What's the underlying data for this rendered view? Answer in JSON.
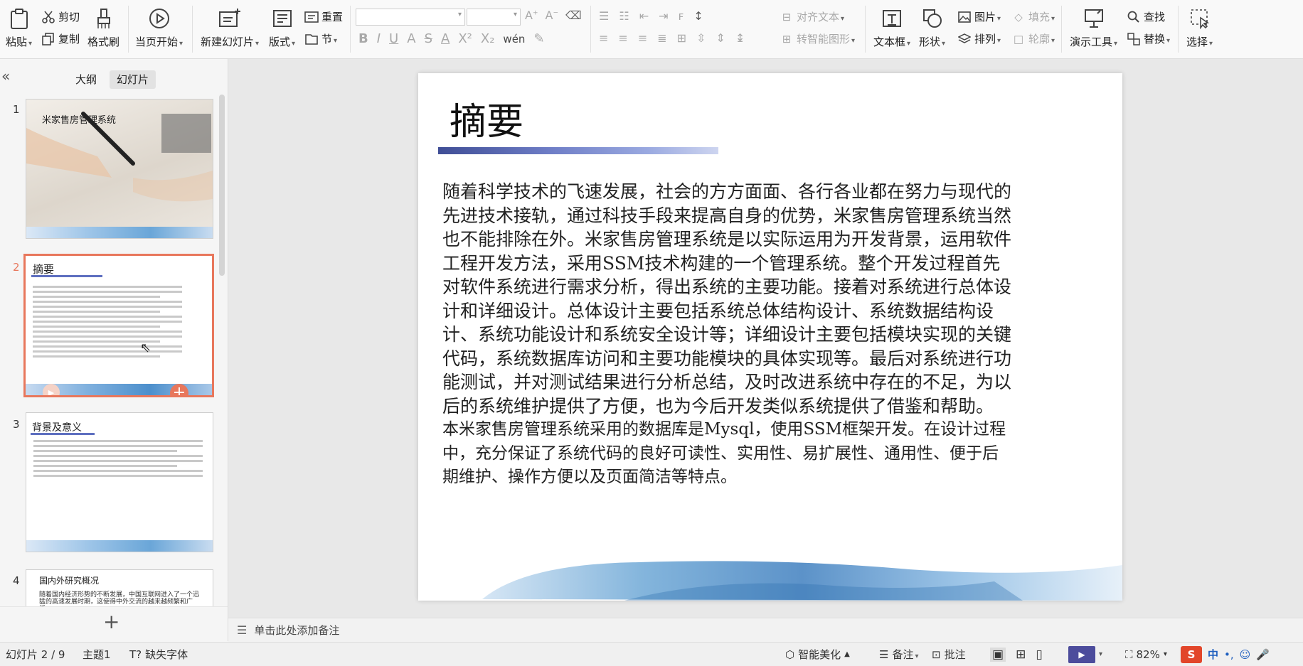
{
  "ribbon": {
    "paste": "粘贴",
    "cut": "剪切",
    "copy": "复制",
    "format_painter": "格式刷",
    "from_current": "当页开始",
    "new_slide": "新建幻灯片",
    "layout": "版式",
    "reset": "重置",
    "section": "节",
    "text_align": "对齐文本",
    "smart_shape": "转智能图形",
    "text_box": "文本框",
    "shape": "形状",
    "picture": "图片",
    "fill": "填充",
    "arrange": "排列",
    "outline": "轮廓",
    "presentation_tools": "演示工具",
    "find": "查找",
    "replace": "替换",
    "select": "选择",
    "font_name": "",
    "font_size": ""
  },
  "panel": {
    "tab_outline": "大纲",
    "tab_slides": "幻灯片",
    "thumbs": [
      {
        "num": "1",
        "title": "米家售房管理系统"
      },
      {
        "num": "2",
        "title": "摘要"
      },
      {
        "num": "3",
        "title": "背景及意义"
      },
      {
        "num": "4",
        "title": "国内外研究概况",
        "snippet": "随着国内经济形势的不断发展，中国互联网进入了一个迅猛的高速发展时期，这使得中外交流的越来越频繁和广泛，"
      }
    ]
  },
  "slide": {
    "title": "摘要",
    "para1": "随着科学技术的飞速发展，社会的方方面面、各行各业都在努力与现代的先进技术接轨，通过科技手段来提高自身的优势，米家售房管理系统当然也不能排除在外。米家售房管理系统是以实际运用为开发背景，运用软件工程开发方法，采用SSM技术构建的一个管理系统。整个开发过程首先对软件系统进行需求分析，得出系统的主要功能。接着对系统进行总体设计和详细设计。总体设计主要包括系统总体结构设计、系统数据结构设计、系统功能设计和系统安全设计等；详细设计主要包括模块实现的关键代码，系统数据库访问和主要功能模块的具体实现等。最后对系统进行功能测试，并对测试结果进行分析总结，及时改进系统中存在的不足，为以后的系统维护提供了方便，也为今后开发类似系统提供了借鉴和帮助。",
    "para2": "本米家售房管理系统采用的数据库是Mysql，使用SSM框架开发。在设计过程中，充分保证了系统代码的良好可读性、实用性、易扩展性、通用性、便于后期维护、操作方便以及页面简洁等特点。"
  },
  "notes": {
    "placeholder": "单击此处添加备注"
  },
  "status": {
    "slide_counter": "幻灯片 2 / 9",
    "theme": "主题1",
    "missing_font": "缺失字体",
    "smart_beautify": "智能美化",
    "notes": "备注",
    "comments": "批注",
    "zoom": "82%",
    "ime": "中"
  },
  "colors": {
    "accent": "#e8775c",
    "ime": "#e2462a",
    "play": "#4c4c9c"
  }
}
